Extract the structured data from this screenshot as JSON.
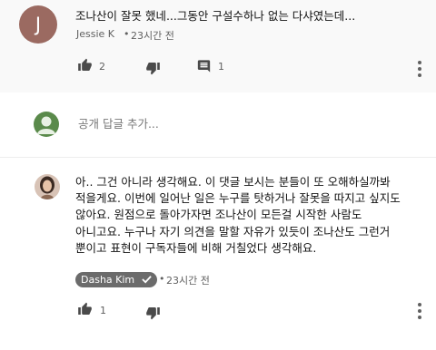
{
  "comment_top": {
    "avatar_letter": "J",
    "text": "조나산이 잘못 했네...그동안 구설수하나 없는 다샤였는데...",
    "author": "Jessie K",
    "time": "23시간 전",
    "likes": "2",
    "replies": "1"
  },
  "reply_box": {
    "placeholder": "공개 답글 추가..."
  },
  "reply": {
    "lines": [
      "아.. 그건 아니라 생각해요. 이 댓글 보시는 분들이 또 오해하실까봐",
      "적을게요. 이번에 일어난 일은 누구를 탓하거나 잘못을 따지고 싶지도",
      "않아요. 원점으로 돌아가자면 조나산이 모든걸 시작한 사람도",
      "아니고요. 누구나 자기 의견을 말할 자유가 있듯이 조나산도 그런거",
      "뿐이고 표현이 구독자들에 비해 거칠었다 생각해요."
    ],
    "author": "Dasha Kim",
    "time": "23시간 전",
    "likes": "1"
  },
  "colors": {
    "avatar_j": "#9b6a61",
    "avatar_g": "#5a8a4b",
    "badge": "#6b6b6b"
  }
}
